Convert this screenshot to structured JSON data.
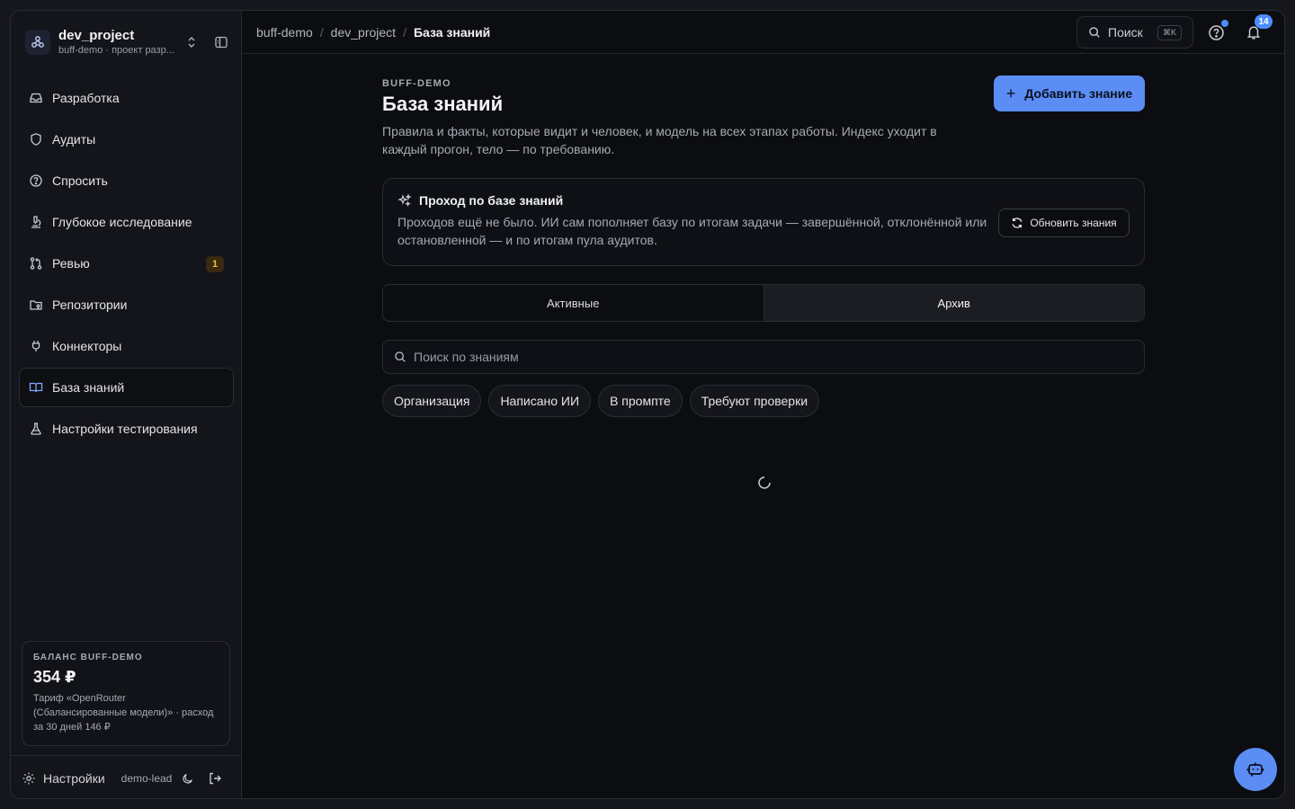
{
  "project": {
    "name": "dev_project",
    "subtitle": "buff-demo · проект разр..."
  },
  "sidebar": {
    "items": [
      {
        "label": "Разработка",
        "icon": "inbox-icon"
      },
      {
        "label": "Аудиты",
        "icon": "shield-icon"
      },
      {
        "label": "Спросить",
        "icon": "help-circle-icon"
      },
      {
        "label": "Глубокое исследование",
        "icon": "microscope-icon"
      },
      {
        "label": "Ревью",
        "icon": "git-pull-request-icon",
        "badge": "1"
      },
      {
        "label": "Репозитории",
        "icon": "folder-git-icon"
      },
      {
        "label": "Коннекторы",
        "icon": "plug-icon"
      },
      {
        "label": "База знаний",
        "icon": "book-open-icon",
        "active": true
      },
      {
        "label": "Настройки тестирования",
        "icon": "flask-icon"
      }
    ]
  },
  "balance": {
    "label": "БАЛАНС BUFF-DEMO",
    "value": "354 ₽",
    "description": "Тариф «OpenRouter (Сбалансированные модели)» · расход за 30 дней 146 ₽"
  },
  "footer": {
    "settings_label": "Настройки",
    "user": "demo-lead"
  },
  "breadcrumbs": [
    "buff-demo",
    "dev_project",
    "База знаний"
  ],
  "topbar": {
    "search_label": "Поиск",
    "search_shortcut": "⌘K",
    "notifications_count": "14"
  },
  "page": {
    "eyebrow": "BUFF-DEMO",
    "title": "База знаний",
    "description": "Правила и факты, которые видит и человек, и модель на всех этапах работы. Индекс уходит в каждый прогон, тело — по требованию.",
    "add_button": "Добавить знание"
  },
  "pass_card": {
    "title": "Проход по базе знаний",
    "description": "Проходов ещё не было. ИИ сам пополняет базу по итогам задачи — завершённой, отклонённой или остановленной — и по итогам пула аудитов.",
    "refresh_button": "Обновить знания"
  },
  "tabs": [
    {
      "label": "Активные",
      "selected": false
    },
    {
      "label": "Архив",
      "selected": true
    }
  ],
  "kb_search": {
    "placeholder": "Поиск по знаниям"
  },
  "filters": [
    "Организация",
    "Написано ИИ",
    "В промпте",
    "Требуют проверки"
  ],
  "colors": {
    "accent": "#5b8df5",
    "badge_text": "#f2b845"
  }
}
